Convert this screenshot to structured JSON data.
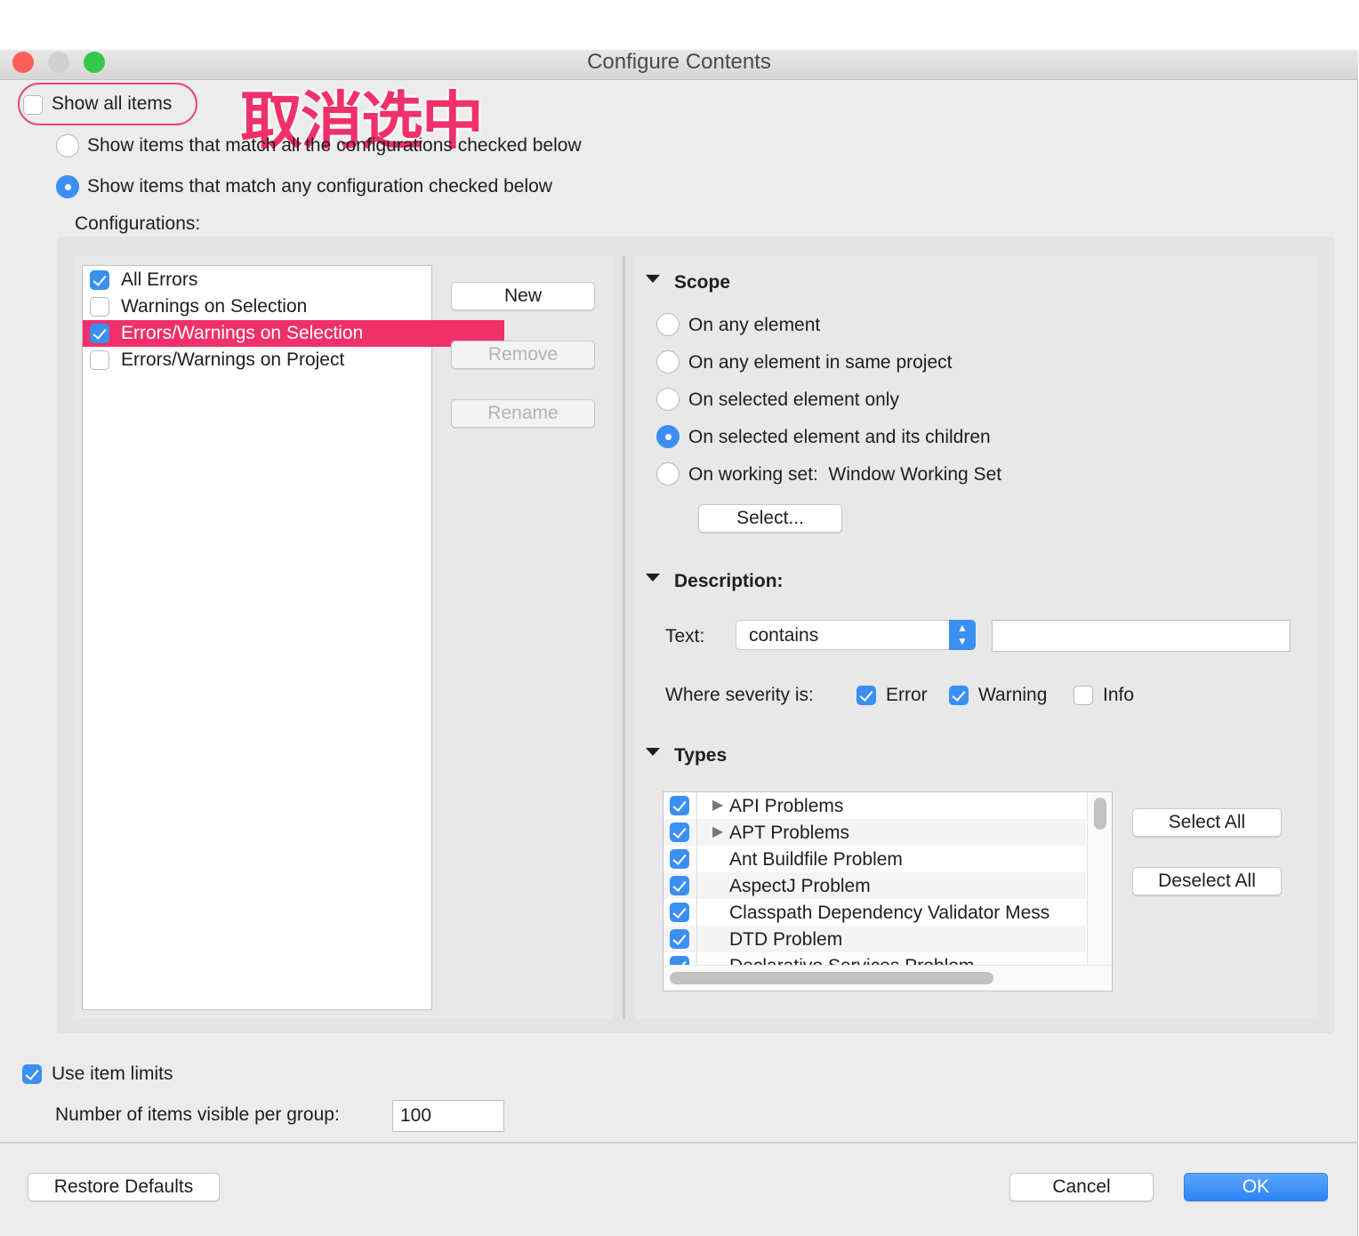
{
  "window": {
    "title": "Configure Contents"
  },
  "annotation": {
    "text": "取消选中",
    "color": "#f0306a"
  },
  "show_all": {
    "label": "Show all items",
    "checked": false
  },
  "match_options": [
    {
      "label": "Show items that match all the configurations checked below",
      "selected": false
    },
    {
      "label": "Show items that match any configuration checked below",
      "selected": true
    }
  ],
  "configurations": {
    "label": "Configurations:",
    "items": [
      {
        "label": "All Errors",
        "checked": true
      },
      {
        "label": "Warnings on Selection",
        "checked": false
      },
      {
        "label": "Errors/Warnings on Selection",
        "checked": true,
        "selected": true
      },
      {
        "label": "Errors/Warnings on Project",
        "checked": false
      }
    ],
    "buttons": {
      "new": "New",
      "remove": "Remove",
      "rename": "Rename"
    }
  },
  "scope": {
    "title": "Scope",
    "options": [
      {
        "label": "On any element",
        "selected": false
      },
      {
        "label": "On any element in same project",
        "selected": false
      },
      {
        "label": "On selected element only",
        "selected": false
      },
      {
        "label": "On selected element and its children",
        "selected": true
      },
      {
        "label": "On working set:  Window Working Set",
        "selected": false
      }
    ],
    "select_button": "Select..."
  },
  "description": {
    "title": "Description:",
    "text_label": "Text:",
    "operator": "contains",
    "value": "",
    "severity_label": "Where severity is:",
    "severities": [
      {
        "label": "Error",
        "checked": true
      },
      {
        "label": "Warning",
        "checked": true
      },
      {
        "label": "Info",
        "checked": false
      }
    ]
  },
  "types": {
    "title": "Types",
    "items": [
      {
        "label": "API Problems",
        "checked": true,
        "expandable": true
      },
      {
        "label": "APT Problems",
        "checked": true,
        "expandable": true
      },
      {
        "label": "Ant Buildfile Problem",
        "checked": true
      },
      {
        "label": "AspectJ Problem",
        "checked": true
      },
      {
        "label": "Classpath Dependency Validator Mess",
        "checked": true
      },
      {
        "label": "DTD Problem",
        "checked": true
      },
      {
        "label": "Declarative Services Problem",
        "checked": true
      }
    ],
    "select_all": "Select All",
    "deselect_all": "Deselect All"
  },
  "limits": {
    "use_label": "Use item limits",
    "use_checked": true,
    "count_label": "Number of items visible per group:",
    "count_value": "100"
  },
  "footer": {
    "restore": "Restore Defaults",
    "cancel": "Cancel",
    "ok": "OK"
  },
  "colors": {
    "accent": "#3b8ff3",
    "selection": "#f0306a"
  }
}
